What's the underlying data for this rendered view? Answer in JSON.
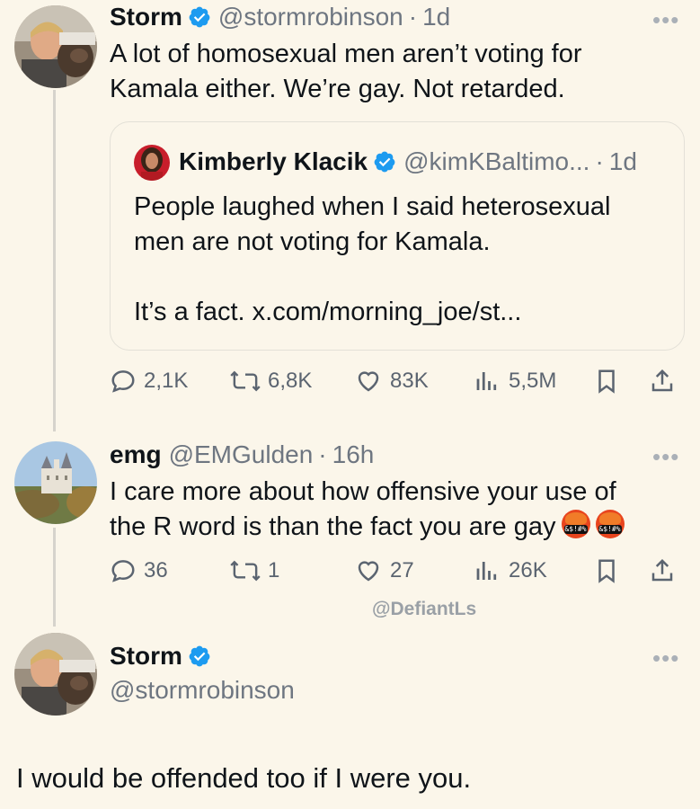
{
  "tweet1": {
    "name": "Storm",
    "handle": "@stormrobinson",
    "time": "1d",
    "text_line1": "A lot of homosexual men aren’t voting for",
    "text_line2": "Kamala either. We’re gay. Not retarded.",
    "quote": {
      "name": "Kimberly Klacik",
      "handle": "@kimKBaltimo...",
      "time": "1d",
      "line1": "People laughed when I said heterosexual",
      "line2": "men are not voting for Kamala.",
      "line3": "It’s a fact. x.com/morning_joe/st..."
    },
    "actions": {
      "replies": "2,1K",
      "reposts": "6,8K",
      "likes": "83K",
      "views": "5,5M"
    }
  },
  "tweet2": {
    "name": "emg",
    "handle": "@EMGulden",
    "time": "16h",
    "text_line1": "I care more about how offensive your use of",
    "text_line2": "the R word is than the fact you are gay",
    "emoji_label": "&$!#%",
    "actions": {
      "replies": "36",
      "reposts": "1",
      "likes": "27",
      "views": "26K"
    }
  },
  "watermark": "@DefiantLs",
  "tweet3": {
    "name": "Storm",
    "handle": "@stormrobinson",
    "text": "I would be offended too if I were you."
  },
  "colors": {
    "background": "#fbf6ea",
    "verified": "#1d9bf0",
    "muted": "#6e7681"
  },
  "icons": [
    "verified-badge-icon",
    "more-icon",
    "reply-icon",
    "repost-icon",
    "like-icon",
    "views-icon",
    "bookmark-icon",
    "share-icon",
    "face-with-symbols-on-mouth-emoji"
  ]
}
